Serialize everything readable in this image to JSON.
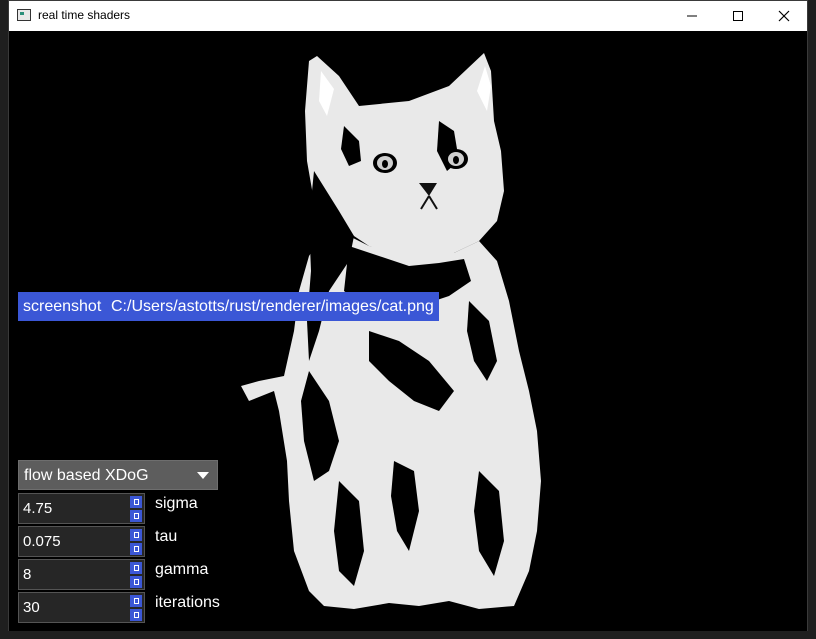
{
  "window": {
    "title": "real time shaders"
  },
  "titlebar_icons": {
    "app": "app-icon",
    "minimize": "minimize-icon",
    "maximize": "maximize-icon",
    "close": "close-icon"
  },
  "toolbar": {
    "screenshot_label": "screenshot",
    "image_path": "C:/Users/astotts/rust/renderer/images/cat.png"
  },
  "filter": {
    "selected": "flow based XDoG"
  },
  "params": [
    {
      "name": "sigma",
      "value": "4.75"
    },
    {
      "name": "tau",
      "value": "0.075"
    },
    {
      "name": "gamma",
      "value": "8"
    },
    {
      "name": "iterations",
      "value": "30"
    }
  ],
  "colors": {
    "accent": "#3b57d6",
    "viewport_bg": "#000000",
    "titlebar_bg": "#ffffff"
  }
}
